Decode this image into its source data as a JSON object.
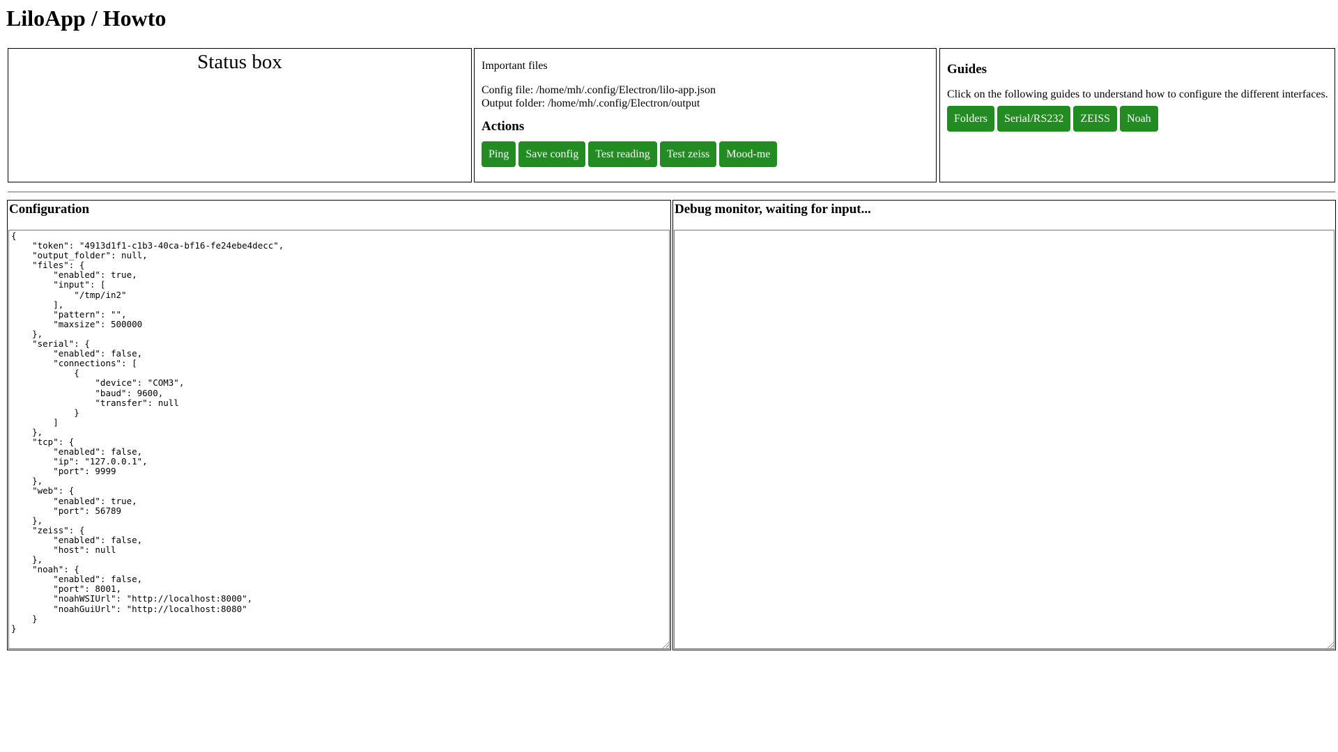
{
  "app": {
    "title": "LiloApp / Howto"
  },
  "status": {
    "heading": "Status box"
  },
  "files": {
    "label": "Important files",
    "config_file": "Config file: /home/mh/.config/Electron/lilo-app.json",
    "output_folder": "Output folder: /home/mh/.config/Electron/output"
  },
  "actions": {
    "heading": "Actions",
    "buttons": [
      "Ping",
      "Save config",
      "Test reading",
      "Test zeiss",
      "Mood-me"
    ]
  },
  "guides": {
    "heading": "Guides",
    "description": "Click on the following guides to understand how to configure the different interfaces.",
    "buttons": [
      "Folders",
      "Serial/RS232",
      "ZEISS",
      "Noah"
    ]
  },
  "configuration": {
    "title": "Configuration",
    "text": "{\n    \"token\": \"4913d1f1-c1b3-40ca-bf16-fe24ebe4decc\",\n    \"output_folder\": null,\n    \"files\": {\n        \"enabled\": true,\n        \"input\": [\n            \"/tmp/in2\"\n        ],\n        \"pattern\": \"\",\n        \"maxsize\": 500000\n    },\n    \"serial\": {\n        \"enabled\": false,\n        \"connections\": [\n            {\n                \"device\": \"COM3\",\n                \"baud\": 9600,\n                \"transfer\": null\n            }\n        ]\n    },\n    \"tcp\": {\n        \"enabled\": false,\n        \"ip\": \"127.0.0.1\",\n        \"port\": 9999\n    },\n    \"web\": {\n        \"enabled\": true,\n        \"port\": 56789\n    },\n    \"zeiss\": {\n        \"enabled\": false,\n        \"host\": null\n    },\n    \"noah\": {\n        \"enabled\": false,\n        \"port\": 8001,\n        \"noahWSIUrl\": \"http://localhost:8000\",\n        \"noahGuiUrl\": \"http://localhost:8080\"\n    }\n}"
  },
  "debug": {
    "title": "Debug monitor, waiting for input...",
    "text": ""
  },
  "colors": {
    "button_bg": "#228B22",
    "button_text": "#ffffff"
  }
}
